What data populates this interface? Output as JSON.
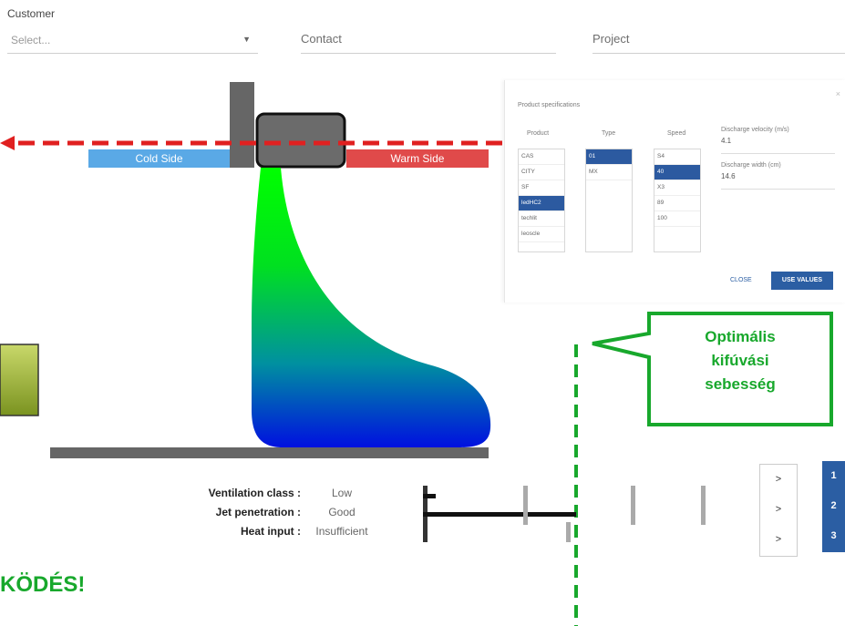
{
  "header": {
    "customer_label": "Customer",
    "customer_placeholder": "Select...",
    "contact_label": "Contact",
    "project_label": "Project"
  },
  "diagram": {
    "cold_side": "Cold Side",
    "warm_side": "Warm Side"
  },
  "spec_panel": {
    "title": "Product specifications",
    "col_product": "Product",
    "col_type": "Type",
    "col_speed": "Speed",
    "products": [
      "CAS",
      "CITY",
      "SF",
      "ledHC2",
      "techlit",
      "leoscle"
    ],
    "products_selected": 3,
    "types": [
      "01",
      "MX"
    ],
    "types_selected": 0,
    "speeds": [
      "S4",
      "40",
      "X3",
      "89",
      "100"
    ],
    "speeds_selected": 1,
    "discharge_velocity_label": "Discharge velocity (m/s)",
    "discharge_velocity_value": "4.1",
    "discharge_width_label": "Discharge width (cm)",
    "discharge_width_value": "14.6",
    "close_label": "CLOSE",
    "use_values_label": "USE VALUES"
  },
  "metrics": [
    {
      "label": "Ventilation class :",
      "value": "Low"
    },
    {
      "label": "Jet penetration :",
      "value": "Good"
    },
    {
      "label": "Heat input :",
      "value": "Insufficient"
    }
  ],
  "nav_buttons": [
    ">",
    ">",
    ">"
  ],
  "nav_numbers": [
    "1",
    "2",
    "3"
  ],
  "callout": {
    "line1": "Optimális",
    "line2": "kifúvási",
    "line3": "sebesség"
  },
  "footer_text": "KÖDÉS!",
  "colors": {
    "cold": "#5aa9e6",
    "warm": "#e04a4a",
    "accent_green": "#18a82c",
    "annotation_red": "#e02020",
    "nav_blue": "#2b5ea3"
  }
}
